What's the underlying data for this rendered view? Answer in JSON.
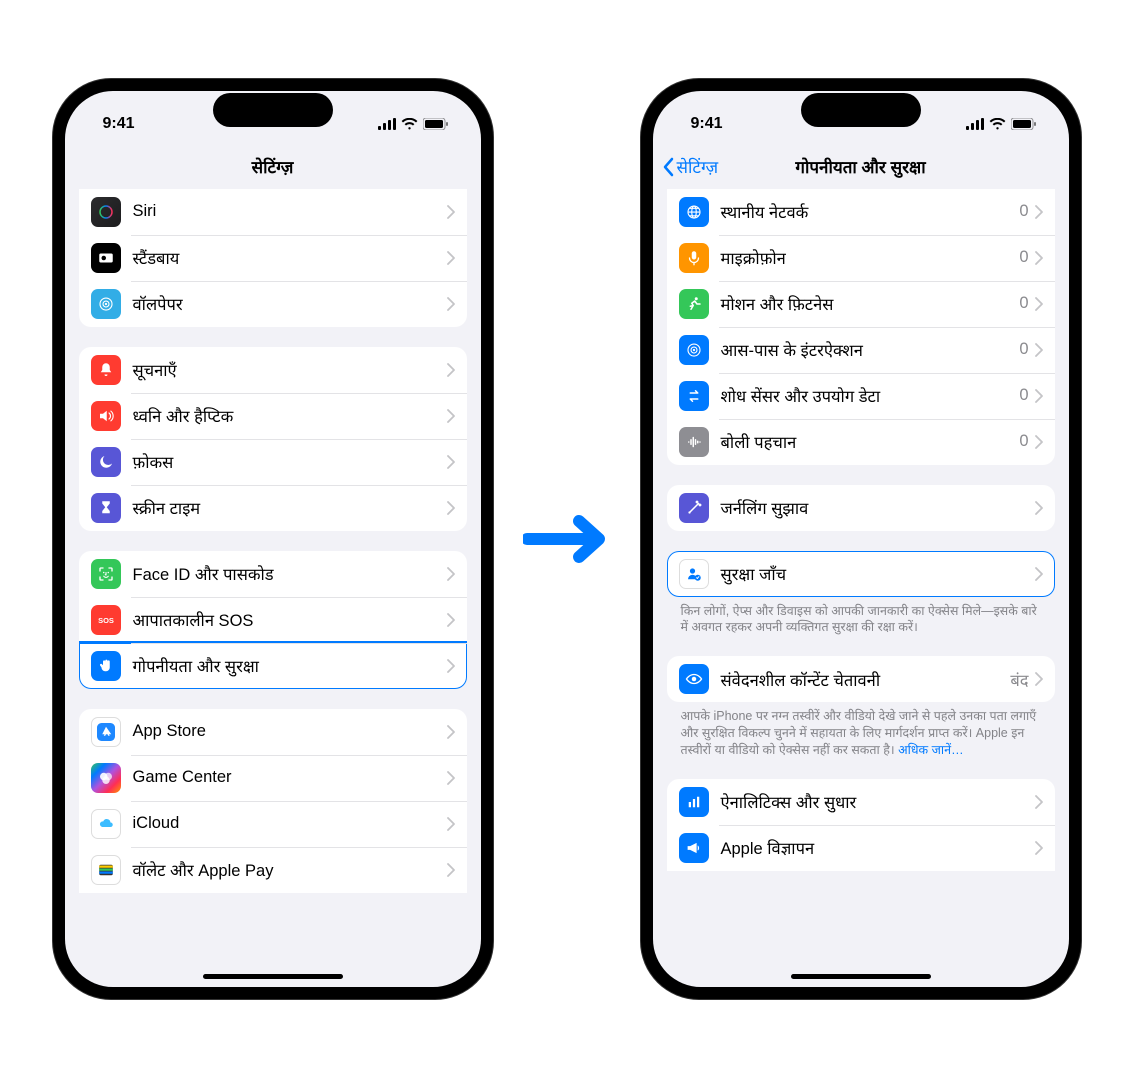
{
  "status": {
    "time": "9:41"
  },
  "phone1": {
    "title": "सेटिंग्ज़",
    "groups": [
      {
        "cutTop": true,
        "rows": [
          {
            "icon": "siri-icon",
            "bg": "bg-siri",
            "label": "Siri"
          },
          {
            "icon": "standby-icon",
            "bg": "bg-black",
            "label": "स्टैंडबाय"
          },
          {
            "icon": "wallpaper-icon",
            "bg": "bg-teal",
            "label": "वॉलपेपर"
          }
        ]
      },
      {
        "rows": [
          {
            "icon": "bell-icon",
            "bg": "bg-red",
            "label": "सूचनाएँ"
          },
          {
            "icon": "speaker-icon",
            "bg": "bg-red2",
            "label": "ध्वनि और हैप्टिक"
          },
          {
            "icon": "moon-icon",
            "bg": "bg-purple",
            "label": "फ़ोकस"
          },
          {
            "icon": "hourglass-icon",
            "bg": "bg-purple2",
            "label": "स्क्रीन टाइम"
          }
        ]
      },
      {
        "rows": [
          {
            "icon": "faceid-icon",
            "bg": "bg-green",
            "label": "Face ID और पासकोड"
          },
          {
            "icon": "sos-icon",
            "bg": "bg-red",
            "label": "आपातकालीन SOS"
          },
          {
            "icon": "hand-icon",
            "bg": "bg-blue",
            "label": "गोपनीयता और सुरक्षा",
            "highlighted": true
          }
        ]
      },
      {
        "cutBottom": true,
        "rows": [
          {
            "icon": "appstore-icon",
            "bg": "bg-white",
            "label": "App Store"
          },
          {
            "icon": "gamecenter-icon",
            "bg": "bg-gradmulti",
            "label": "Game Center"
          },
          {
            "icon": "icloud-icon",
            "bg": "bg-icloud",
            "label": "iCloud"
          },
          {
            "icon": "wallet-icon",
            "bg": "bg-white",
            "label": "वॉलेट और Apple Pay"
          }
        ]
      }
    ]
  },
  "phone2": {
    "back": "सेटिंग्ज़",
    "title": "गोपनीयता और सुरक्षा",
    "groups": [
      {
        "cutTop": true,
        "rows": [
          {
            "icon": "globe-icon",
            "bg": "bg-blue",
            "label": "स्थानीय नेटवर्क",
            "value": "0"
          },
          {
            "icon": "mic-icon",
            "bg": "bg-orange",
            "label": "माइक्रोफ़ोन",
            "value": "0"
          },
          {
            "icon": "runner-icon",
            "bg": "bg-green",
            "label": "मोशन और फ़िटनेस",
            "value": "0"
          },
          {
            "icon": "target-icon",
            "bg": "bg-blue",
            "label": "आस-पास के इंटरऐक्शन",
            "value": "0"
          },
          {
            "icon": "swap-icon",
            "bg": "bg-blue",
            "label": "शोध सेंसर और उपयोग डेटा",
            "value": "0"
          },
          {
            "icon": "waveform-icon",
            "bg": "bg-gray",
            "label": "बोली पहचान",
            "value": "0"
          }
        ]
      },
      {
        "rows": [
          {
            "icon": "wand-icon",
            "bg": "bg-purple",
            "label": "जर्नलिंग सुझाव"
          }
        ]
      },
      {
        "single": true,
        "rows": [
          {
            "icon": "personcheck-icon",
            "bg": "bg-white",
            "iconColor": "#007aff",
            "label": "सुरक्षा जाँच",
            "highlighted": true
          }
        ],
        "footer": "किन लोगों, ऐप्स और डिवाइस को आपकी जानकारी का ऐक्सेस मिले—इसके बारे में अवगत रहकर अपनी व्यक्तिगत सुरक्षा की रक्षा करें।"
      },
      {
        "rows": [
          {
            "icon": "eye-icon",
            "bg": "bg-blue",
            "label": "संवेदनशील कॉन्टेंट चेतावनी",
            "value": "बंद"
          }
        ],
        "footer": "आपके iPhone पर नग्न तस्वीरें और वीडियो देखे जाने से पहले उनका पता लगाएँ और सुरक्षित विकल्प चुनने में सहायता के लिए मार्गदर्शन प्राप्त करें। Apple इन तस्वीरों या वीडियो को ऐक्सेस नहीं कर सकता है।",
        "footerLink": "अधिक जानें…"
      },
      {
        "cutBottom": true,
        "rows": [
          {
            "icon": "chart-icon",
            "bg": "bg-blue",
            "label": "ऐनालिटिक्स और सुधार"
          },
          {
            "icon": "megaphone-icon",
            "bg": "bg-blue",
            "label": "Apple विज्ञापन"
          }
        ]
      }
    ]
  }
}
